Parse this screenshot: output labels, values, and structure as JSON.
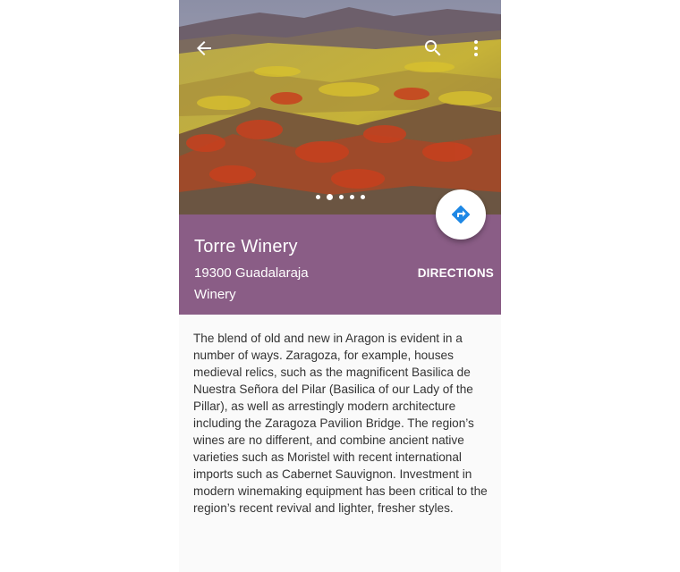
{
  "place": {
    "name": "Torre Winery",
    "address": "19300 Guadalaraja",
    "category": "Winery",
    "directions_label": "DIRECTIONS",
    "description": "The blend of old and new in Aragon is evident in a number of ways. Zaragoza, for example, houses medieval relics, such as the magnificent Basilica de Nuestra Señora del Pilar (Basilica of our Lady of the Pillar), as well as arrestingly modern architecture including the Zaragoza Pavilion Bridge. The region’s wines are no different, and combine ancient native varieties such as Moristel with recent international imports such as Cabernet Sauvignon. Investment in modern winemaking equipment has been critical to the region’s recent revival and lighter, fresher styles."
  },
  "toolbar": {
    "back_icon": "arrow-back-icon",
    "search_icon": "search-icon",
    "more_icon": "more-vert-icon"
  },
  "carousel": {
    "page_count": 5,
    "active_index": 1
  },
  "fab": {
    "icon": "directions-icon",
    "color": "#1e88e5"
  },
  "colors": {
    "info_background": "#8a5d86",
    "page_background": "#fafafa"
  }
}
